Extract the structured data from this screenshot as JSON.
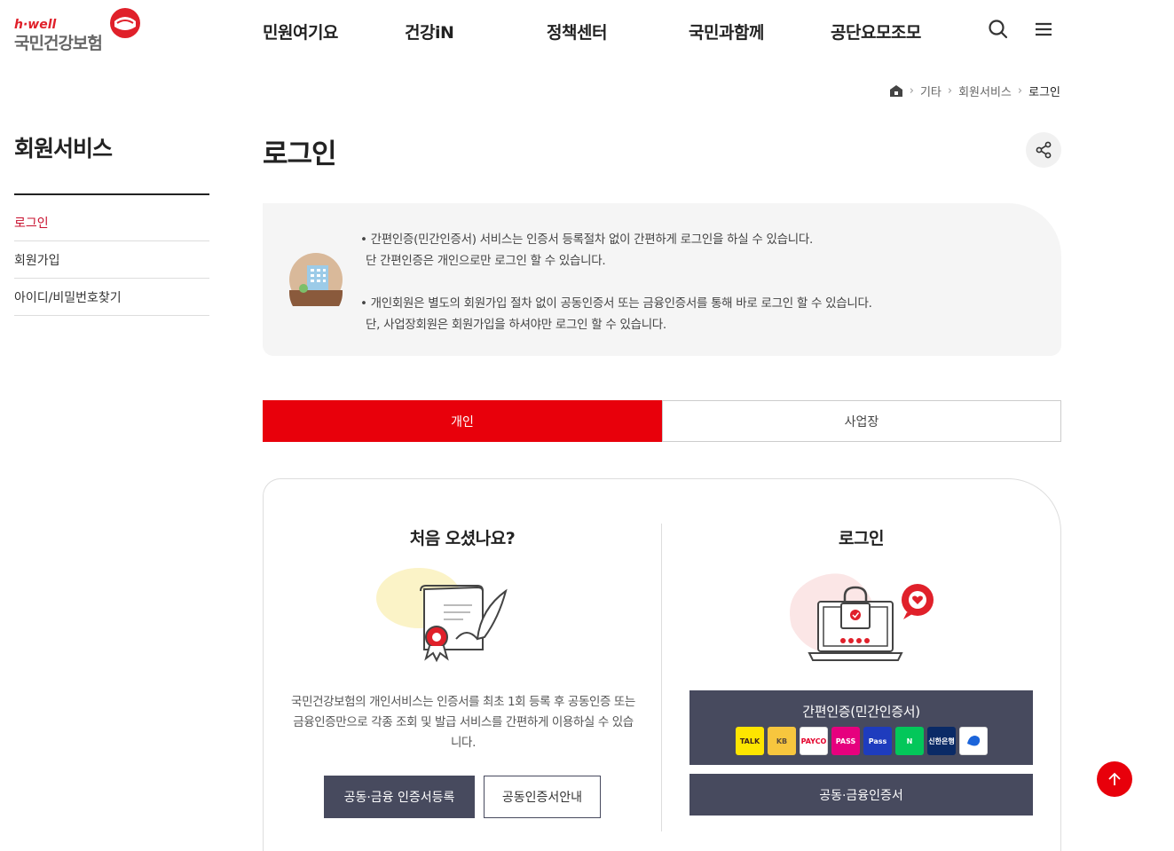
{
  "header": {
    "logo_eng": "h·well",
    "logo_kor": "국민건강보험",
    "nav": [
      "민원여기요",
      "건강iN",
      "정책센터",
      "국민과함께",
      "공단요모조모"
    ],
    "search_icon": "search-icon",
    "menu_icon": "hamburger-menu-icon"
  },
  "breadcrumb": {
    "home_icon": "home-icon",
    "items": [
      "기타",
      "회원서비스",
      "로그인"
    ]
  },
  "sidebar": {
    "title": "회원서비스",
    "items": [
      {
        "label": "로그인",
        "active": true
      },
      {
        "label": "회원가입",
        "active": false
      },
      {
        "label": "아이디/비밀번호찾기",
        "active": false
      }
    ]
  },
  "main": {
    "title": "로그인",
    "share_icon": "share-icon",
    "notice": {
      "icon": "building-icon",
      "lines": [
        "• 간편인증(민간인증서) 서비스는 인증서 등록절차 없이 간편하게 로그인을 하실 수 있습니다.",
        "단 간편인증은 개인으로만 로그인 할 수 있습니다.",
        "• 개인회원은 별도의 회원가입 절차 없이 공동인증서 또는 금융인증서를 통해 바로 로그인 할 수 있습니다.",
        "단, 사업장회원은 회원가입을 하셔야만 로그인 할 수 있습니다."
      ]
    },
    "tabs": [
      {
        "label": "개인",
        "active": true
      },
      {
        "label": "사업장",
        "active": false
      }
    ],
    "first_visit": {
      "title": "처음 오셨나요?",
      "illustration": "certificate-quill-icon",
      "description": "국민건강보험의 개인서비스는 인증서를 최초 1회 등록 후 공동인증 또는 금융인증만으로 각종 조회 및 발급 서비스를 간편하게 이용하실 수 있습니다.",
      "register_button": "공동·금융 인증서등록",
      "guide_button": "공동인증서안내"
    },
    "login": {
      "title": "로그인",
      "illustration": "laptop-lock-icon",
      "simple_auth_button": "간편인증(민간인증서)",
      "providers": [
        {
          "name": "kakao-talk-icon",
          "label": "TALK",
          "bg": "#fee500",
          "fg": "#3c1e1e"
        },
        {
          "name": "kb-icon",
          "label": "KB",
          "bg": "#f7c63e",
          "fg": "#5a4a3a"
        },
        {
          "name": "payco-icon",
          "label": "PAYCO",
          "bg": "#ffffff",
          "fg": "#e4002b"
        },
        {
          "name": "pass-icon",
          "label": "PASS",
          "bg": "#e6007e",
          "fg": "#ffffff"
        },
        {
          "name": "samsung-pass-icon",
          "label": "Pass",
          "bg": "#1e3cbe",
          "fg": "#ffffff"
        },
        {
          "name": "naver-icon",
          "label": "N",
          "bg": "#03c75a",
          "fg": "#ffffff"
        },
        {
          "name": "shinhan-icon",
          "label": "신한은행",
          "bg": "#0a2a66",
          "fg": "#ffffff"
        },
        {
          "name": "toss-icon",
          "label": "",
          "bg": "#ffffff",
          "fg": "#1b64da"
        }
      ],
      "cert_button": "공동·금융인증서"
    }
  },
  "scroll_top_icon": "arrow-up-icon",
  "colors": {
    "accent": "#e8000b",
    "dark_button": "#474a5e",
    "active_side": "#c8102e"
  }
}
